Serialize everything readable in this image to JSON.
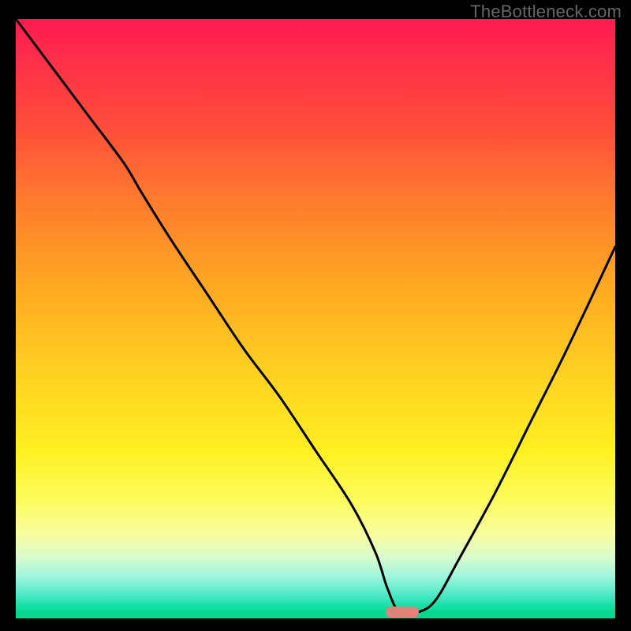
{
  "watermark": "TheBottleneck.com",
  "marker": {
    "x_pct": 64.5,
    "y_pct": 99.0,
    "color": "#e4807a"
  },
  "chart_data": {
    "type": "line",
    "title": "",
    "xlabel": "",
    "ylabel": "",
    "xlim": [
      0,
      100
    ],
    "ylim": [
      0,
      100
    ],
    "grid": false,
    "legend": false,
    "note": "The curve depicts bottleneck percentage vs. an implicit component-balance axis. Values are read from the rendered curve in percent-of-plot coordinates; y = 100 means top (high bottleneck), y = 0 means bottom.",
    "series": [
      {
        "name": "bottleneck-curve",
        "color": "#000000",
        "x": [
          0,
          6,
          12,
          18,
          21,
          26,
          32,
          38,
          44,
          50,
          56,
          60,
          62,
          64,
          67,
          70,
          74,
          80,
          86,
          92,
          100
        ],
        "y": [
          100,
          92,
          84,
          76,
          71,
          63,
          54,
          45,
          37,
          28,
          19,
          11,
          5,
          1,
          1,
          3,
          10,
          21,
          33,
          45,
          62
        ]
      }
    ],
    "background_gradient_stops": [
      {
        "pct": 0,
        "color": "#ff1a50"
      },
      {
        "pct": 18,
        "color": "#ff4d3a"
      },
      {
        "pct": 45,
        "color": "#ffaa21"
      },
      {
        "pct": 72,
        "color": "#fff021"
      },
      {
        "pct": 90,
        "color": "#d7fbcf"
      },
      {
        "pct": 100,
        "color": "#07d88f"
      }
    ]
  }
}
